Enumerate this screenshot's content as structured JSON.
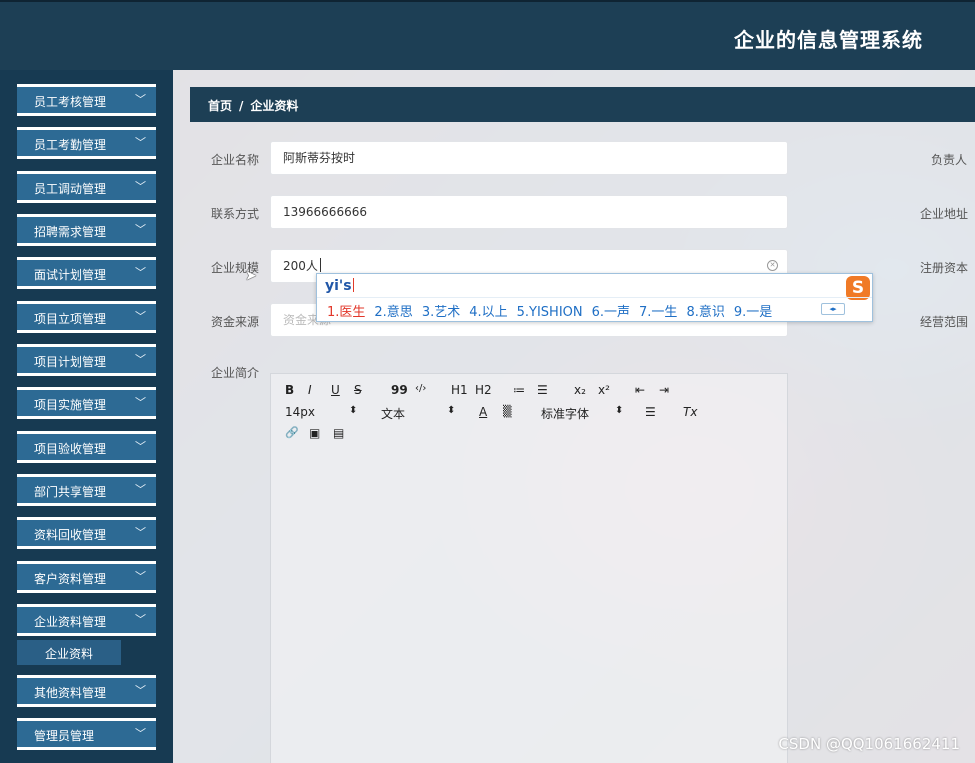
{
  "header": {
    "title": "企业的信息管理系统"
  },
  "sidebar": {
    "items": [
      {
        "label": "员工考核管理"
      },
      {
        "label": "员工考勤管理"
      },
      {
        "label": "员工调动管理"
      },
      {
        "label": "招聘需求管理"
      },
      {
        "label": "面试计划管理"
      },
      {
        "label": "项目立项管理"
      },
      {
        "label": "项目计划管理"
      },
      {
        "label": "项目实施管理"
      },
      {
        "label": "项目验收管理"
      },
      {
        "label": "部门共享管理"
      },
      {
        "label": "资料回收管理"
      },
      {
        "label": "客户资料管理"
      },
      {
        "label": "企业资料管理"
      },
      {
        "label": "其他资料管理"
      },
      {
        "label": "管理员管理"
      }
    ],
    "submenu": {
      "label": "企业资料"
    }
  },
  "breadcrumb": {
    "home": "首页",
    "separator": "/",
    "current": "企业资料"
  },
  "form": {
    "name_label": "企业名称",
    "name_value": "阿斯蒂芬按时",
    "contact_label": "联系方式",
    "contact_value": "13966666666",
    "scale_label": "企业规模",
    "scale_value": "200人",
    "fund_label": "资金来源",
    "fund_placeholder": "资金来源",
    "intro_label": "企业简介",
    "manager_label": "负责人",
    "address_label": "企业地址",
    "capital_label": "注册资本",
    "scope_label": "经营范围"
  },
  "editor": {
    "row1": [
      "B",
      "I",
      "U",
      "S",
      "99",
      "‹/›",
      "H1",
      "H2",
      "≔",
      "☰",
      "x₂",
      "x²",
      "⇤",
      "⇥"
    ],
    "font_size": "14px",
    "text_type": "文本",
    "font_family": "标准字体",
    "updown": "⬍",
    "color_glyph": "A",
    "bg_glyph": "▒",
    "align_glyph": "☰",
    "clear_glyph": "Tx",
    "link_icon": "🔗",
    "image_icon": "▣",
    "video_icon": "▤"
  },
  "ime": {
    "pinyin": "yi's",
    "candidates": [
      "1.医生",
      "2.意思",
      "3.艺术",
      "4.以上",
      "5.YISHION",
      "6.一声",
      "7.一生",
      "8.意识",
      "9.一是"
    ],
    "logo": "S",
    "pager": "◂▸"
  },
  "watermark": "CSDN @QQ1061662411"
}
